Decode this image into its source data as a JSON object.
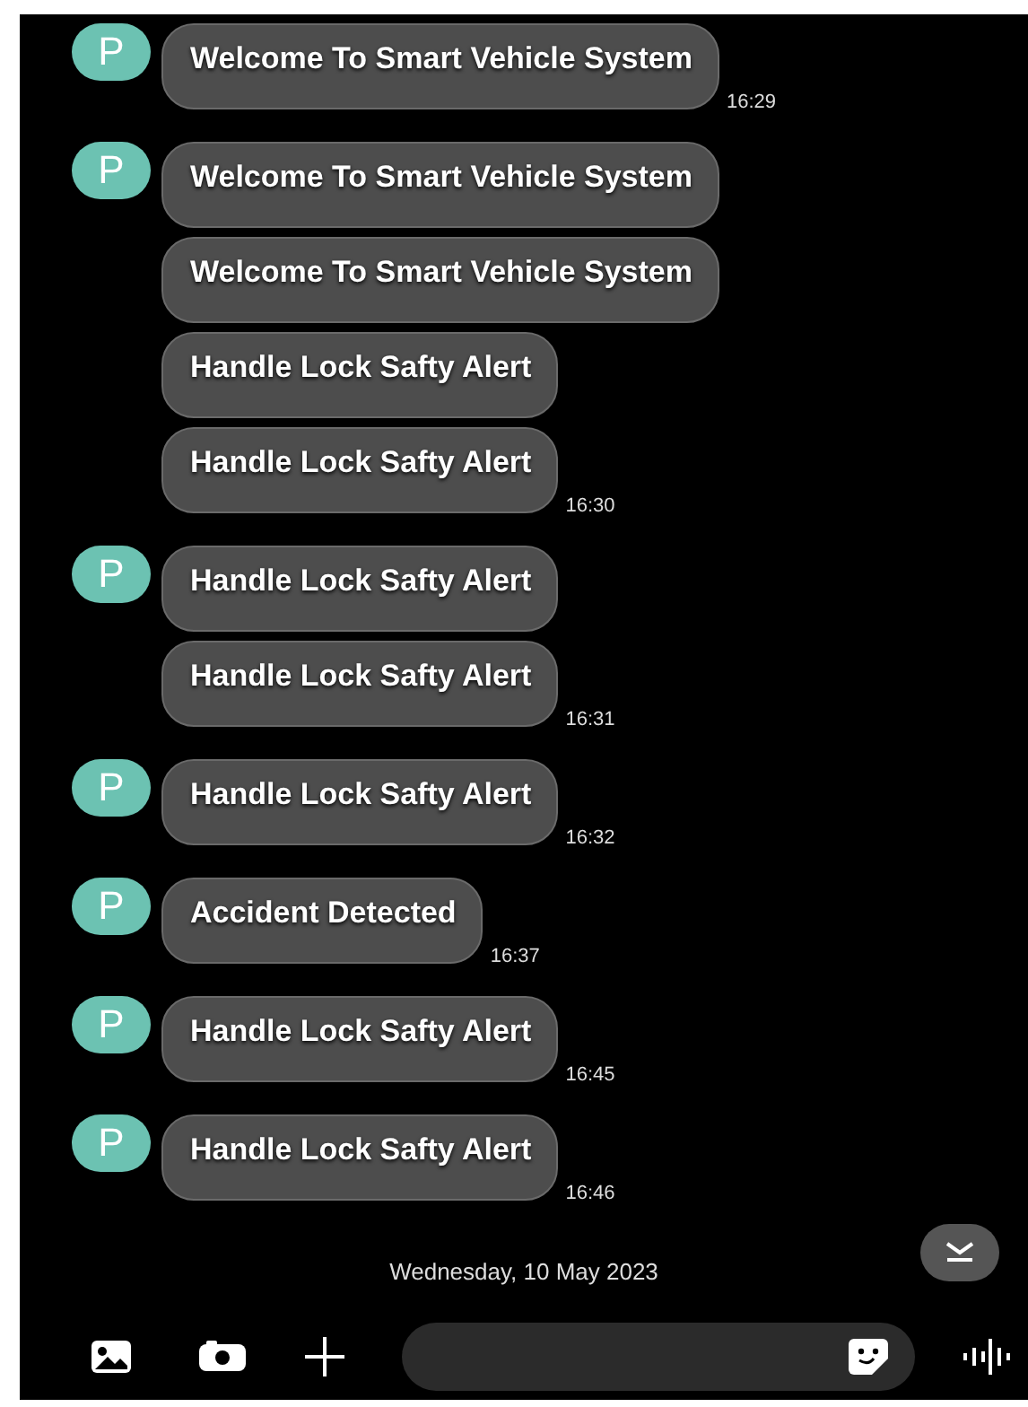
{
  "messages": [
    {
      "avatar": "P",
      "text": "Welcome To Smart Vehicle System",
      "time": "16:29"
    },
    {
      "avatar": "P",
      "text": "Welcome To Smart Vehicle System"
    },
    {
      "text": "Welcome To Smart Vehicle System"
    },
    {
      "text": "Handle Lock Safty Alert"
    },
    {
      "text": "Handle Lock Safty Alert",
      "time": "16:30"
    },
    {
      "avatar": "P",
      "text": "Handle Lock Safty Alert"
    },
    {
      "text": "Handle Lock Safty Alert",
      "time": "16:31"
    },
    {
      "avatar": "P",
      "text": "Handle Lock Safty Alert",
      "time": "16:32"
    },
    {
      "avatar": "P",
      "text": "Accident Detected",
      "time": "16:37"
    },
    {
      "avatar": "P",
      "text": "Handle Lock Safty Alert",
      "time": "16:45"
    },
    {
      "avatar": "P",
      "text": "Handle Lock Safty Alert",
      "time": "16:46"
    }
  ],
  "date_divider": "Wednesday, 10 May 2023"
}
